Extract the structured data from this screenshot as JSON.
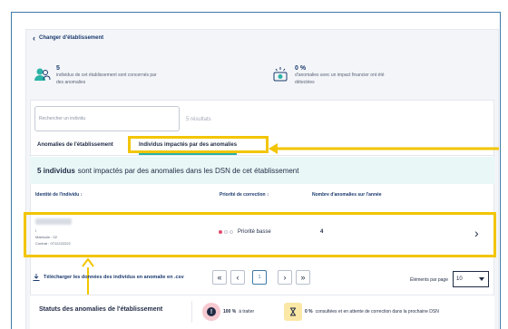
{
  "back_label": "Changer d'établissement",
  "stats": {
    "individuals_count": "5",
    "individuals_desc": "individus de cet établissement sont concernés par des anomalies",
    "percent": "0 %",
    "percent_desc": "d'anomalies avec un impact financier ont été détectées"
  },
  "search": {
    "placeholder": "Rechercher un individu",
    "results": "5 résultats"
  },
  "tabs": [
    {
      "label": "Anomalies de l'établissement"
    },
    {
      "label": "Individus impactés par des anomalies"
    }
  ],
  "banner": {
    "count": "5 individus",
    "text": "sont impactés par des anomalies dans les DSN de cet établissement"
  },
  "table": {
    "headers": [
      "Identité de l'individu ↕",
      "Priorité de correction ↕",
      "Nombre d'anomalies sur l'année"
    ],
    "rows": [
      {
        "line1": "I",
        "line2": "Matricule : 02",
        "line3": "Contrat : 0712222222",
        "priority": "Priorité basse",
        "anomalies": "4"
      }
    ]
  },
  "download_label": "Télécharger les données des individus en anomalie en .csv",
  "pager": {
    "current": "1"
  },
  "per_page": {
    "label": "Éléments par page",
    "value": "10"
  },
  "status": {
    "title": "Statuts des anomalies de l'établissement",
    "todo_pct": "100 %",
    "todo_label": "à traiter",
    "waiting_pct": "0 %",
    "waiting_label": "consultées et en attente de correction dans la prochaine DSN"
  },
  "colors": {
    "highlight": "#f2c500",
    "accent": "#2ab3a6",
    "priority_low": "#e44b6e"
  }
}
